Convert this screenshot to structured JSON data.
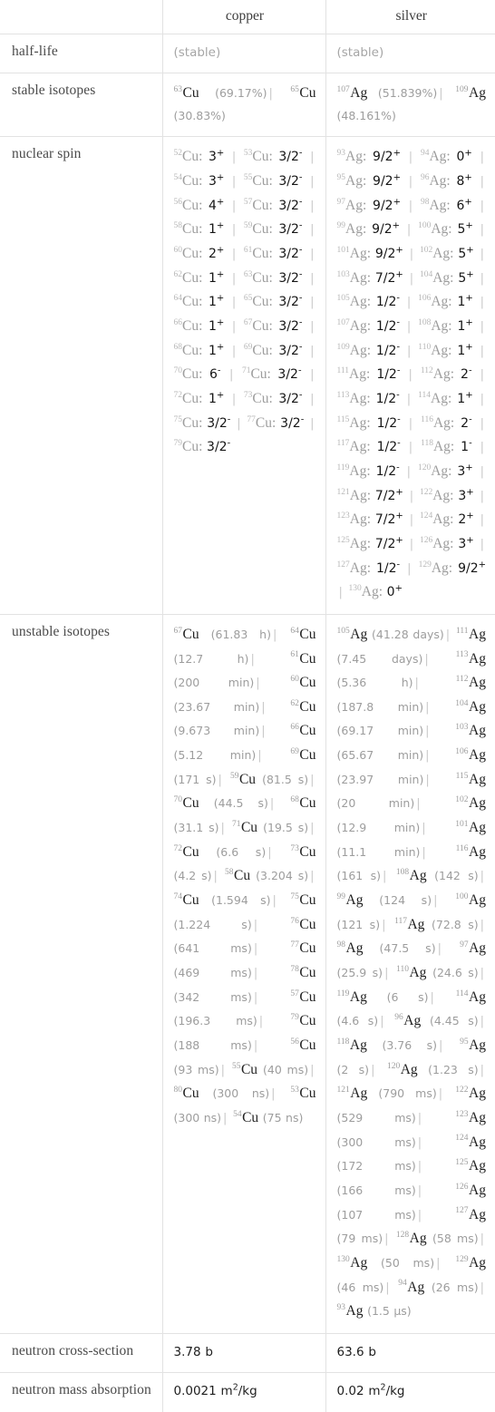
{
  "table": {
    "columns": [
      "",
      "copper",
      "silver"
    ],
    "rows": [
      {
        "label": "half-life",
        "copper": {
          "kind": "muted-text",
          "text": "(stable)"
        },
        "silver": {
          "kind": "muted-text",
          "text": "(stable)"
        }
      },
      {
        "label": "stable isotopes",
        "copper": {
          "kind": "isotope-list",
          "items": [
            {
              "mass": "63",
              "symbol": "Cu",
              "detail": "(69.17%)"
            },
            {
              "mass": "65",
              "symbol": "Cu",
              "detail": "(30.83%)"
            }
          ]
        },
        "silver": {
          "kind": "isotope-list",
          "items": [
            {
              "mass": "107",
              "symbol": "Ag",
              "detail": "(51.839%)"
            },
            {
              "mass": "109",
              "symbol": "Ag",
              "detail": "(48.161%)"
            }
          ]
        }
      },
      {
        "label": "nuclear spin",
        "copper": {
          "kind": "spin-list",
          "items": [
            {
              "mass": "52",
              "symbol": "Cu",
              "spin": "3",
              "sign": "+"
            },
            {
              "mass": "53",
              "symbol": "Cu",
              "spin": "3/2",
              "sign": "-"
            },
            {
              "mass": "54",
              "symbol": "Cu",
              "spin": "3",
              "sign": "+"
            },
            {
              "mass": "55",
              "symbol": "Cu",
              "spin": "3/2",
              "sign": "-"
            },
            {
              "mass": "56",
              "symbol": "Cu",
              "spin": "4",
              "sign": "+"
            },
            {
              "mass": "57",
              "symbol": "Cu",
              "spin": "3/2",
              "sign": "-"
            },
            {
              "mass": "58",
              "symbol": "Cu",
              "spin": "1",
              "sign": "+"
            },
            {
              "mass": "59",
              "symbol": "Cu",
              "spin": "3/2",
              "sign": "-"
            },
            {
              "mass": "60",
              "symbol": "Cu",
              "spin": "2",
              "sign": "+"
            },
            {
              "mass": "61",
              "symbol": "Cu",
              "spin": "3/2",
              "sign": "-"
            },
            {
              "mass": "62",
              "symbol": "Cu",
              "spin": "1",
              "sign": "+"
            },
            {
              "mass": "63",
              "symbol": "Cu",
              "spin": "3/2",
              "sign": "-"
            },
            {
              "mass": "64",
              "symbol": "Cu",
              "spin": "1",
              "sign": "+"
            },
            {
              "mass": "65",
              "symbol": "Cu",
              "spin": "3/2",
              "sign": "-"
            },
            {
              "mass": "66",
              "symbol": "Cu",
              "spin": "1",
              "sign": "+"
            },
            {
              "mass": "67",
              "symbol": "Cu",
              "spin": "3/2",
              "sign": "-"
            },
            {
              "mass": "68",
              "symbol": "Cu",
              "spin": "1",
              "sign": "+"
            },
            {
              "mass": "69",
              "symbol": "Cu",
              "spin": "3/2",
              "sign": "-"
            },
            {
              "mass": "70",
              "symbol": "Cu",
              "spin": "6",
              "sign": "-"
            },
            {
              "mass": "71",
              "symbol": "Cu",
              "spin": "3/2",
              "sign": "-"
            },
            {
              "mass": "72",
              "symbol": "Cu",
              "spin": "1",
              "sign": "+"
            },
            {
              "mass": "73",
              "symbol": "Cu",
              "spin": "3/2",
              "sign": "-"
            },
            {
              "mass": "75",
              "symbol": "Cu",
              "spin": "3/2",
              "sign": "-"
            },
            {
              "mass": "77",
              "symbol": "Cu",
              "spin": "3/2",
              "sign": "-"
            },
            {
              "mass": "79",
              "symbol": "Cu",
              "spin": "3/2",
              "sign": "-"
            }
          ]
        },
        "silver": {
          "kind": "spin-list",
          "items": [
            {
              "mass": "93",
              "symbol": "Ag",
              "spin": "9/2",
              "sign": "+"
            },
            {
              "mass": "94",
              "symbol": "Ag",
              "spin": "0",
              "sign": "+"
            },
            {
              "mass": "95",
              "symbol": "Ag",
              "spin": "9/2",
              "sign": "+"
            },
            {
              "mass": "96",
              "symbol": "Ag",
              "spin": "8",
              "sign": "+"
            },
            {
              "mass": "97",
              "symbol": "Ag",
              "spin": "9/2",
              "sign": "+"
            },
            {
              "mass": "98",
              "symbol": "Ag",
              "spin": "6",
              "sign": "+"
            },
            {
              "mass": "99",
              "symbol": "Ag",
              "spin": "9/2",
              "sign": "+"
            },
            {
              "mass": "100",
              "symbol": "Ag",
              "spin": "5",
              "sign": "+"
            },
            {
              "mass": "101",
              "symbol": "Ag",
              "spin": "9/2",
              "sign": "+"
            },
            {
              "mass": "102",
              "symbol": "Ag",
              "spin": "5",
              "sign": "+"
            },
            {
              "mass": "103",
              "symbol": "Ag",
              "spin": "7/2",
              "sign": "+"
            },
            {
              "mass": "104",
              "symbol": "Ag",
              "spin": "5",
              "sign": "+"
            },
            {
              "mass": "105",
              "symbol": "Ag",
              "spin": "1/2",
              "sign": "-"
            },
            {
              "mass": "106",
              "symbol": "Ag",
              "spin": "1",
              "sign": "+"
            },
            {
              "mass": "107",
              "symbol": "Ag",
              "spin": "1/2",
              "sign": "-"
            },
            {
              "mass": "108",
              "symbol": "Ag",
              "spin": "1",
              "sign": "+"
            },
            {
              "mass": "109",
              "symbol": "Ag",
              "spin": "1/2",
              "sign": "-"
            },
            {
              "mass": "110",
              "symbol": "Ag",
              "spin": "1",
              "sign": "+"
            },
            {
              "mass": "111",
              "symbol": "Ag",
              "spin": "1/2",
              "sign": "-"
            },
            {
              "mass": "112",
              "symbol": "Ag",
              "spin": "2",
              "sign": "-"
            },
            {
              "mass": "113",
              "symbol": "Ag",
              "spin": "1/2",
              "sign": "-"
            },
            {
              "mass": "114",
              "symbol": "Ag",
              "spin": "1",
              "sign": "+"
            },
            {
              "mass": "115",
              "symbol": "Ag",
              "spin": "1/2",
              "sign": "-"
            },
            {
              "mass": "116",
              "symbol": "Ag",
              "spin": "2",
              "sign": "-"
            },
            {
              "mass": "117",
              "symbol": "Ag",
              "spin": "1/2",
              "sign": "-"
            },
            {
              "mass": "118",
              "symbol": "Ag",
              "spin": "1",
              "sign": "-"
            },
            {
              "mass": "119",
              "symbol": "Ag",
              "spin": "1/2",
              "sign": "-"
            },
            {
              "mass": "120",
              "symbol": "Ag",
              "spin": "3",
              "sign": "+"
            },
            {
              "mass": "121",
              "symbol": "Ag",
              "spin": "7/2",
              "sign": "+"
            },
            {
              "mass": "122",
              "symbol": "Ag",
              "spin": "3",
              "sign": "+"
            },
            {
              "mass": "123",
              "symbol": "Ag",
              "spin": "7/2",
              "sign": "+"
            },
            {
              "mass": "124",
              "symbol": "Ag",
              "spin": "2",
              "sign": "+"
            },
            {
              "mass": "125",
              "symbol": "Ag",
              "spin": "7/2",
              "sign": "+"
            },
            {
              "mass": "126",
              "symbol": "Ag",
              "spin": "3",
              "sign": "+"
            },
            {
              "mass": "127",
              "symbol": "Ag",
              "spin": "1/2",
              "sign": "-"
            },
            {
              "mass": "129",
              "symbol": "Ag",
              "spin": "9/2",
              "sign": "+"
            },
            {
              "mass": "130",
              "symbol": "Ag",
              "spin": "0",
              "sign": "+"
            }
          ]
        }
      },
      {
        "label": "unstable isotopes",
        "copper": {
          "kind": "isotope-list",
          "items": [
            {
              "mass": "67",
              "symbol": "Cu",
              "detail": "(61.83 h)"
            },
            {
              "mass": "64",
              "symbol": "Cu",
              "detail": "(12.7 h)"
            },
            {
              "mass": "61",
              "symbol": "Cu",
              "detail": "(200 min)"
            },
            {
              "mass": "60",
              "symbol": "Cu",
              "detail": "(23.67 min)"
            },
            {
              "mass": "62",
              "symbol": "Cu",
              "detail": "(9.673 min)"
            },
            {
              "mass": "66",
              "symbol": "Cu",
              "detail": "(5.12 min)"
            },
            {
              "mass": "69",
              "symbol": "Cu",
              "detail": "(171 s)"
            },
            {
              "mass": "59",
              "symbol": "Cu",
              "detail": "(81.5 s)"
            },
            {
              "mass": "70",
              "symbol": "Cu",
              "detail": "(44.5 s)"
            },
            {
              "mass": "68",
              "symbol": "Cu",
              "detail": "(31.1 s)"
            },
            {
              "mass": "71",
              "symbol": "Cu",
              "detail": "(19.5 s)"
            },
            {
              "mass": "72",
              "symbol": "Cu",
              "detail": "(6.6 s)"
            },
            {
              "mass": "73",
              "symbol": "Cu",
              "detail": "(4.2 s)"
            },
            {
              "mass": "58",
              "symbol": "Cu",
              "detail": "(3.204 s)"
            },
            {
              "mass": "74",
              "symbol": "Cu",
              "detail": "(1.594 s)"
            },
            {
              "mass": "75",
              "symbol": "Cu",
              "detail": "(1.224 s)"
            },
            {
              "mass": "76",
              "symbol": "Cu",
              "detail": "(641 ms)"
            },
            {
              "mass": "77",
              "symbol": "Cu",
              "detail": "(469 ms)"
            },
            {
              "mass": "78",
              "symbol": "Cu",
              "detail": "(342 ms)"
            },
            {
              "mass": "57",
              "symbol": "Cu",
              "detail": "(196.3 ms)"
            },
            {
              "mass": "79",
              "symbol": "Cu",
              "detail": "(188 ms)"
            },
            {
              "mass": "56",
              "symbol": "Cu",
              "detail": "(93 ms)"
            },
            {
              "mass": "55",
              "symbol": "Cu",
              "detail": "(40 ms)"
            },
            {
              "mass": "80",
              "symbol": "Cu",
              "detail": "(300 ns)"
            },
            {
              "mass": "53",
              "symbol": "Cu",
              "detail": "(300 ns)"
            },
            {
              "mass": "54",
              "symbol": "Cu",
              "detail": "(75 ns)"
            }
          ]
        },
        "silver": {
          "kind": "isotope-list",
          "items": [
            {
              "mass": "105",
              "symbol": "Ag",
              "detail": "(41.28 days)"
            },
            {
              "mass": "111",
              "symbol": "Ag",
              "detail": "(7.45 days)"
            },
            {
              "mass": "113",
              "symbol": "Ag",
              "detail": "(5.36 h)"
            },
            {
              "mass": "112",
              "symbol": "Ag",
              "detail": "(187.8 min)"
            },
            {
              "mass": "104",
              "symbol": "Ag",
              "detail": "(69.17 min)"
            },
            {
              "mass": "103",
              "symbol": "Ag",
              "detail": "(65.67 min)"
            },
            {
              "mass": "106",
              "symbol": "Ag",
              "detail": "(23.97 min)"
            },
            {
              "mass": "115",
              "symbol": "Ag",
              "detail": "(20 min)"
            },
            {
              "mass": "102",
              "symbol": "Ag",
              "detail": "(12.9 min)"
            },
            {
              "mass": "101",
              "symbol": "Ag",
              "detail": "(11.1 min)"
            },
            {
              "mass": "116",
              "symbol": "Ag",
              "detail": "(161 s)"
            },
            {
              "mass": "108",
              "symbol": "Ag",
              "detail": "(142 s)"
            },
            {
              "mass": "99",
              "symbol": "Ag",
              "detail": "(124 s)"
            },
            {
              "mass": "100",
              "symbol": "Ag",
              "detail": "(121 s)"
            },
            {
              "mass": "117",
              "symbol": "Ag",
              "detail": "(72.8 s)"
            },
            {
              "mass": "98",
              "symbol": "Ag",
              "detail": "(47.5 s)"
            },
            {
              "mass": "97",
              "symbol": "Ag",
              "detail": "(25.9 s)"
            },
            {
              "mass": "110",
              "symbol": "Ag",
              "detail": "(24.6 s)"
            },
            {
              "mass": "119",
              "symbol": "Ag",
              "detail": "(6 s)"
            },
            {
              "mass": "114",
              "symbol": "Ag",
              "detail": "(4.6 s)"
            },
            {
              "mass": "96",
              "symbol": "Ag",
              "detail": "(4.45 s)"
            },
            {
              "mass": "118",
              "symbol": "Ag",
              "detail": "(3.76 s)"
            },
            {
              "mass": "95",
              "symbol": "Ag",
              "detail": "(2 s)"
            },
            {
              "mass": "120",
              "symbol": "Ag",
              "detail": "(1.23 s)"
            },
            {
              "mass": "121",
              "symbol": "Ag",
              "detail": "(790 ms)"
            },
            {
              "mass": "122",
              "symbol": "Ag",
              "detail": "(529 ms)"
            },
            {
              "mass": "123",
              "symbol": "Ag",
              "detail": "(300 ms)"
            },
            {
              "mass": "124",
              "symbol": "Ag",
              "detail": "(172 ms)"
            },
            {
              "mass": "125",
              "symbol": "Ag",
              "detail": "(166 ms)"
            },
            {
              "mass": "126",
              "symbol": "Ag",
              "detail": "(107 ms)"
            },
            {
              "mass": "127",
              "symbol": "Ag",
              "detail": "(79 ms)"
            },
            {
              "mass": "128",
              "symbol": "Ag",
              "detail": "(58 ms)"
            },
            {
              "mass": "130",
              "symbol": "Ag",
              "detail": "(50 ms)"
            },
            {
              "mass": "129",
              "symbol": "Ag",
              "detail": "(46 ms)"
            },
            {
              "mass": "94",
              "symbol": "Ag",
              "detail": "(26 ms)"
            },
            {
              "mass": "93",
              "symbol": "Ag",
              "detail": "(1.5 µs)"
            }
          ]
        }
      },
      {
        "label": "neutron cross-section",
        "copper": {
          "kind": "value",
          "text": "3.78 b"
        },
        "silver": {
          "kind": "value",
          "text": "63.6 b"
        }
      },
      {
        "label": "neutron mass absorption",
        "copper": {
          "kind": "value-sup",
          "pre": "0.0021 m",
          "sup": "2",
          "post": "/kg"
        },
        "silver": {
          "kind": "value-sup",
          "pre": "0.02 m",
          "sup": "2",
          "post": "/kg"
        }
      }
    ]
  },
  "colors": {
    "border": "#e2e2e2",
    "label_text": "#4a4a4a",
    "value_text": "#1f1f1f",
    "muted_text": "#a6a6a6",
    "separator": "#c9c9c9",
    "background": "#ffffff"
  }
}
